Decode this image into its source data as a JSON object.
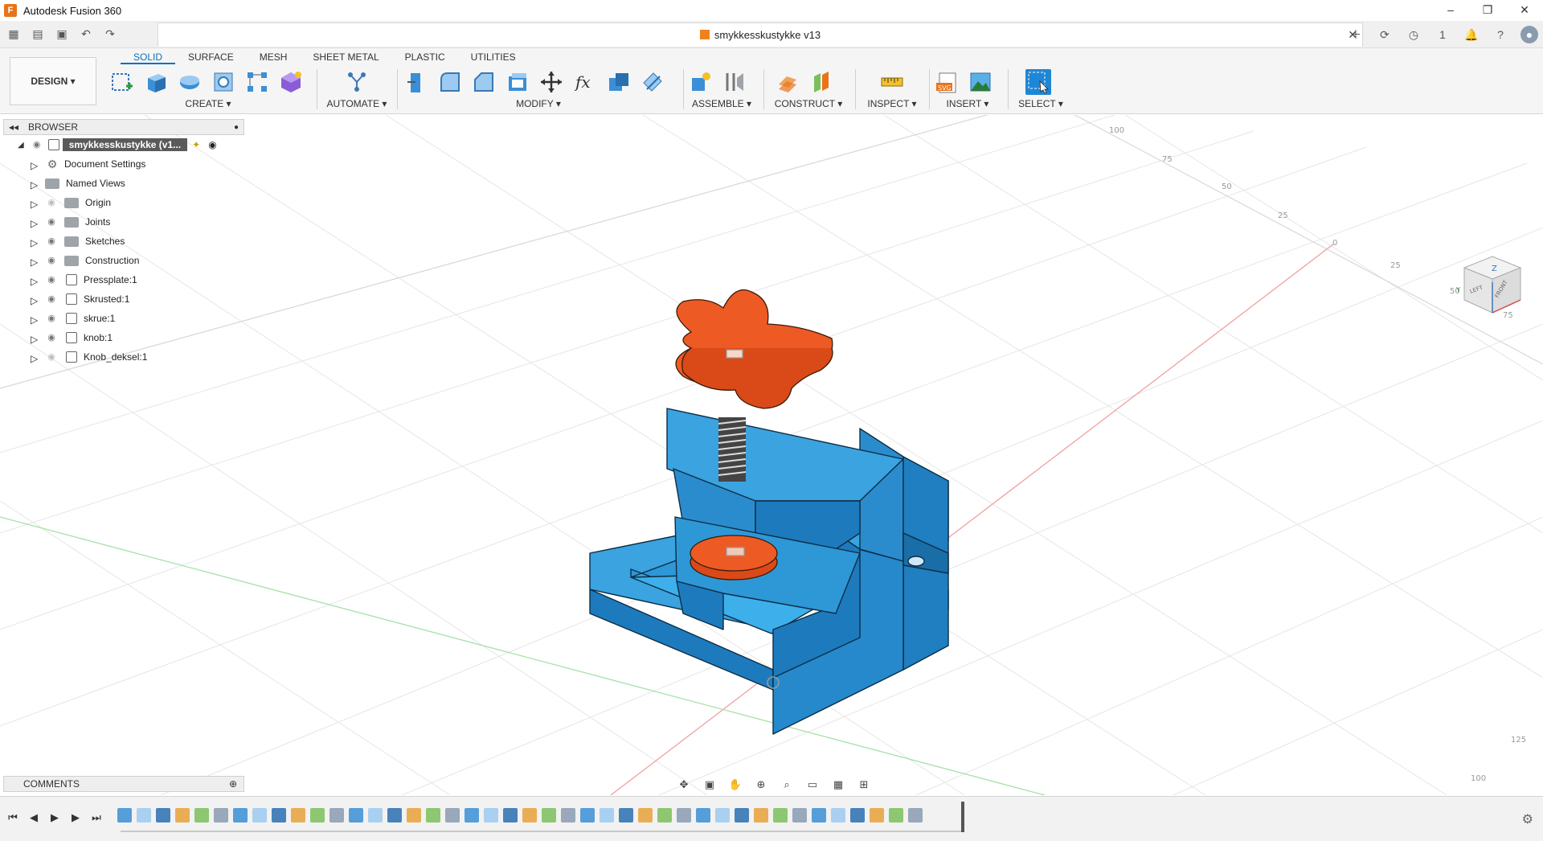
{
  "app": {
    "title": "Autodesk Fusion 360",
    "logo": "F"
  },
  "document": {
    "title": "smykkesskustykke v13",
    "notifications": "1"
  },
  "window_controls": {
    "minimize": "–",
    "restore": "❐",
    "close": "✕"
  },
  "ribbon": {
    "workspace_label": "DESIGN ▾",
    "tabs": [
      {
        "label": "SOLID",
        "active": true
      },
      {
        "label": "SURFACE",
        "active": false
      },
      {
        "label": "MESH",
        "active": false
      },
      {
        "label": "SHEET METAL",
        "active": false
      },
      {
        "label": "PLASTIC",
        "active": false
      },
      {
        "label": "UTILITIES",
        "active": false
      }
    ],
    "groups": {
      "create": "CREATE ▾",
      "automate": "AUTOMATE ▾",
      "modify": "MODIFY ▾",
      "assemble": "ASSEMBLE ▾",
      "construct": "CONSTRUCT ▾",
      "inspect": "INSPECT ▾",
      "insert": "INSERT ▾",
      "select": "SELECT ▾"
    },
    "colors": {
      "accent": "#0a70b8",
      "select_active": "#1e86d6"
    }
  },
  "browser": {
    "header": "BROWSER",
    "root": "smykkesskustykke (v1...",
    "items": [
      {
        "label": "Document Settings",
        "kind": "settings"
      },
      {
        "label": "Named Views",
        "kind": "folder"
      },
      {
        "label": "Origin",
        "kind": "folder"
      },
      {
        "label": "Joints",
        "kind": "folder"
      },
      {
        "label": "Sketches",
        "kind": "folder"
      },
      {
        "label": "Construction",
        "kind": "folder"
      },
      {
        "label": "Pressplate:1",
        "kind": "component"
      },
      {
        "label": "Skrusted:1",
        "kind": "component"
      },
      {
        "label": "skrue:1",
        "kind": "component"
      },
      {
        "label": "knob:1",
        "kind": "component"
      },
      {
        "label": "Knob_deksel:1",
        "kind": "component"
      }
    ]
  },
  "comments": {
    "label": "COMMENTS"
  },
  "viewcube": {
    "top": "Z",
    "left": "LEFT",
    "front": "FRONT",
    "axis_y": "Y"
  },
  "grid_labels": [
    "100",
    "75",
    "50",
    "25",
    "0",
    "25",
    "50",
    "75",
    "125",
    "100"
  ],
  "model": {
    "body_color": "#2e9bd6",
    "knob_color": "#ee5a24"
  }
}
